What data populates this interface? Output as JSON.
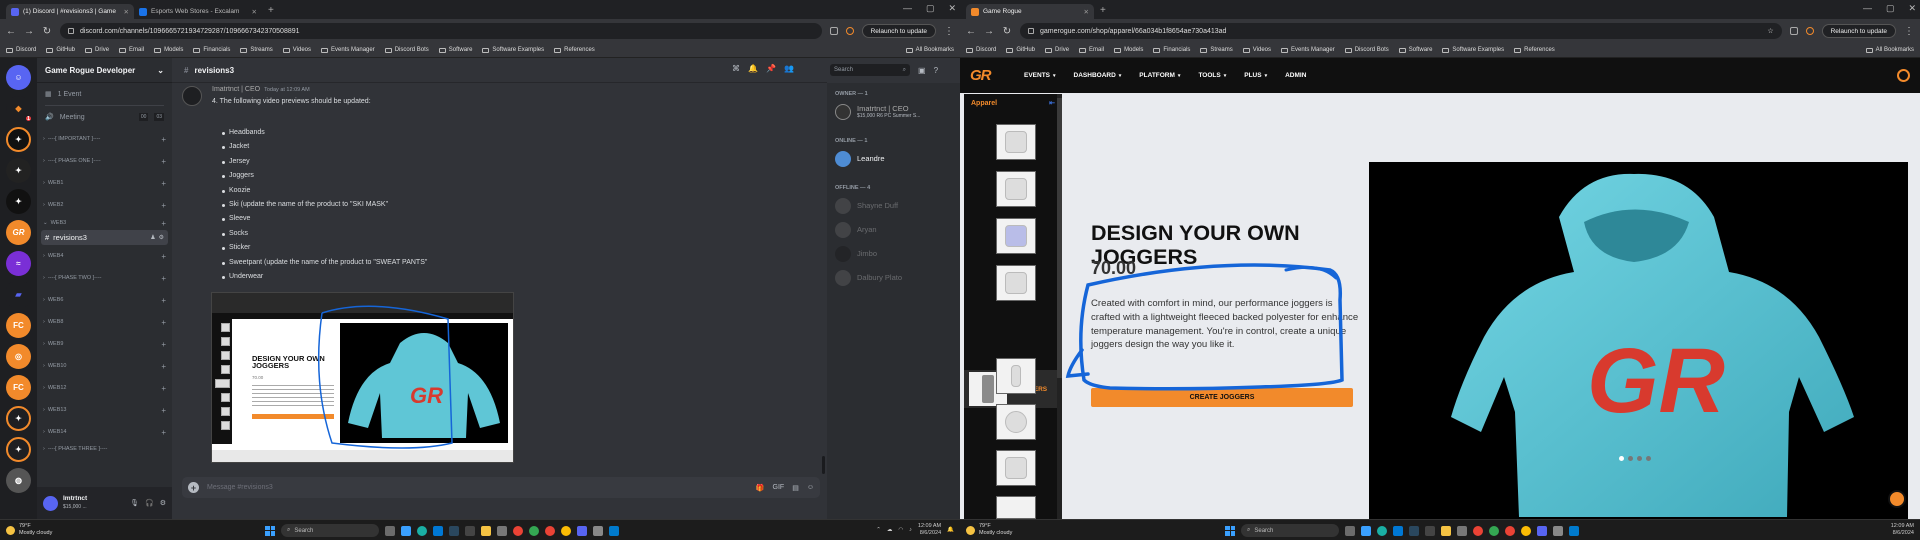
{
  "left": {
    "tabs": [
      {
        "label": "(1) Discord | #revisions3 | Game",
        "active": true,
        "color": "#5865f2"
      },
      {
        "label": "Esports Web Stores - Excalam",
        "active": false,
        "color": "#1a73e8"
      }
    ],
    "url": "discord.com/channels/1096665721934729287/1096667342370508891",
    "relaunch": "Relaunch to update",
    "bookmarks": [
      "Discord",
      "GitHub",
      "Drive",
      "Email",
      "Models",
      "Financials",
      "Streams",
      "Videos",
      "Events Manager",
      "Discord Bots",
      "Software",
      "Software Examples",
      "References"
    ],
    "all_bookmarks": "All Bookmarks",
    "server_name": "Game Rogue Developer",
    "events": "1 Event",
    "voice": {
      "name": "Meeting",
      "tag1": "00",
      "tag2": "03"
    },
    "categories_top": [
      "----[ IMPORTANT ]----",
      "----[ PHASE ONE ]----",
      "WEB1",
      "WEB2",
      "WEB3"
    ],
    "selected_channel": "revisions3",
    "categories_bottom": [
      "WEB4",
      "----[ PHASE TWO ]----",
      "WEB6",
      "WEB8",
      "WEB9",
      "WEB10",
      "WEB12",
      "WEB13",
      "WEB14",
      "----[ PHASE THREE ]----"
    ],
    "server_badges": {
      "red_badge": "1"
    },
    "user": {
      "name": "Imtrtnct",
      "sub": "$15,000 ..."
    },
    "channel_title": "revisions3",
    "search_placeholder": "Search",
    "message": {
      "author": "Imatrtnct | CEO",
      "time": "Today at 12:09 AM",
      "intro": "4. The following video previews should be updated:",
      "items": [
        "Headbands",
        "Jacket",
        "Jersey",
        "Joggers",
        "Koozie",
        "Ski (update the name of the product to \"SKI MASK\"",
        "Sleeve",
        "Socks",
        "Sticker",
        "Sweetpant (update the name of the product to \"SWEAT PANTS\"",
        "Underwear"
      ]
    },
    "thumb": {
      "title": "DESIGN YOUR OWN JOGGERS",
      "price": "70.00"
    },
    "input_placeholder": "Message #revisions3",
    "members": {
      "owner_header": "OWNER — 1",
      "owner": {
        "name": "Imatrtnct | CEO",
        "sub": "$15,000 R6 PC Summer S..."
      },
      "online_header": "ONLINE — 1",
      "online": [
        "Leandre"
      ],
      "offline_header": "OFFLINE — 4",
      "offline": [
        "Shayne Duff",
        "Aryan",
        "Jimbo",
        "Dalbury Plato"
      ]
    },
    "weather": {
      "temp": "79°F",
      "cond": "Mostly cloudy"
    },
    "taskbar_search": "Search",
    "clock": {
      "time": "12:09 AM",
      "date": "8/6/2024"
    }
  },
  "right": {
    "tabs": [
      {
        "label": "Game Rogue",
        "active": true,
        "color": "#f28a2b"
      }
    ],
    "url": "gamerogue.com/shop/apparel/66a034b1f8654ae730a413ad",
    "relaunch": "Relaunch to update",
    "logo": "GR",
    "nav": [
      {
        "label": "EVENTS",
        "chev": "▾"
      },
      {
        "label": "DASHBOARD",
        "chev": "▾"
      },
      {
        "label": "PLATFORM",
        "chev": "▾"
      },
      {
        "label": "TOOLS",
        "chev": "▾"
      },
      {
        "label": "PLUS",
        "chev": "▾"
      },
      {
        "label": "ADMIN",
        "chev": ""
      }
    ],
    "sidebar_title": "Apparel",
    "collapse_icon": "⇤",
    "selected_product": "JOGGERS",
    "title": "DESIGN YOUR OWN JOGGERS",
    "price": "70.00",
    "description": "Created with comfort in mind, our performance joggers is crafted with a lightweight fleeced backed polyester for enhance temperature management. You're in control, create a unique joggers design the way you like it.",
    "button": "CREATE JOGGERS",
    "hoodie_logo": "GR",
    "carousel_active": 1,
    "colors": {
      "accent": "#f28a2b",
      "hoodie": "#5fc6d6",
      "logo_red": "#d83a2e",
      "annotation": "#1565d8"
    },
    "weather": {
      "temp": "79°F",
      "cond": "Mostly cloudy"
    },
    "taskbar_search": "Search",
    "clock": {
      "time": "12:09 AM",
      "date": "8/6/2024"
    }
  }
}
